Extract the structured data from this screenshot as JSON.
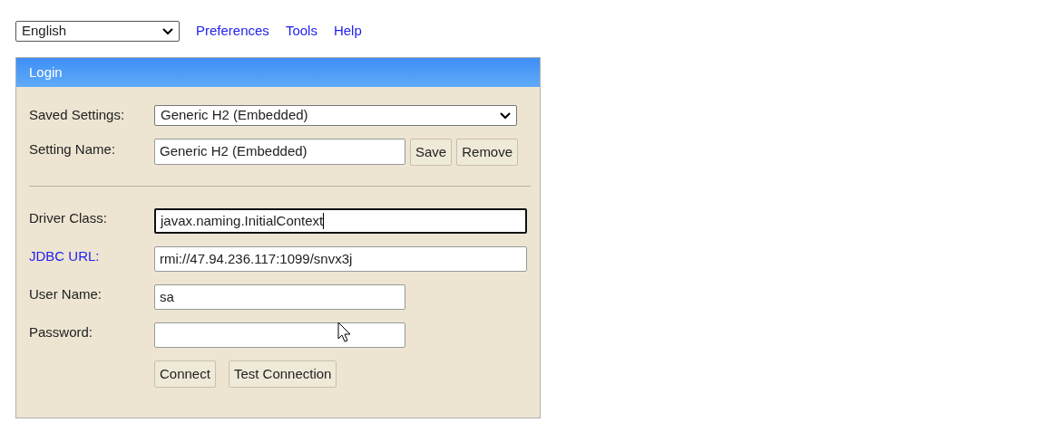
{
  "language": "English",
  "menu": [
    "Preferences",
    "Tools",
    "Help"
  ],
  "login": {
    "title": "Login",
    "saved_settings": {
      "label": "Saved Settings:",
      "value": "Generic H2 (Embedded)"
    },
    "setting_name": {
      "label": "Setting Name:",
      "value": "Generic H2 (Embedded)",
      "buttons": [
        "Save",
        "Remove"
      ]
    },
    "fields": [
      {
        "label": "Driver Class:",
        "value": "javax.naming.InitialContext",
        "kind": "long",
        "focused": true,
        "link": false
      },
      {
        "label": "JDBC URL:",
        "value": "rmi://47.94.236.117:1099/snvx3j",
        "kind": "long",
        "focused": false,
        "link": true
      },
      {
        "label": "User Name:",
        "value": "sa",
        "kind": "short",
        "focused": false,
        "link": false
      },
      {
        "label": "Password:",
        "kind": "short",
        "focused": false,
        "link": false
      }
    ],
    "buttons": [
      "Connect",
      "Test Connection"
    ]
  }
}
